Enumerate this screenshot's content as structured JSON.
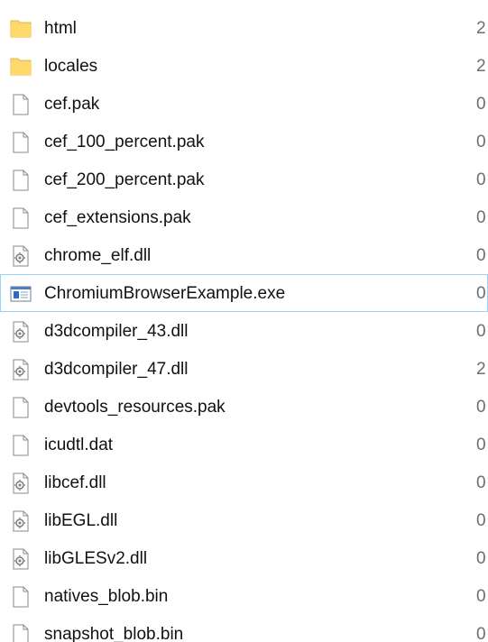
{
  "files": [
    {
      "name": "html",
      "type": "folder",
      "col": "2"
    },
    {
      "name": "locales",
      "type": "folder",
      "col": "2"
    },
    {
      "name": "cef.pak",
      "type": "file",
      "col": "0"
    },
    {
      "name": "cef_100_percent.pak",
      "type": "file",
      "col": "0"
    },
    {
      "name": "cef_200_percent.pak",
      "type": "file",
      "col": "0"
    },
    {
      "name": "cef_extensions.pak",
      "type": "file",
      "col": "0"
    },
    {
      "name": "chrome_elf.dll",
      "type": "dll",
      "col": "0"
    },
    {
      "name": "ChromiumBrowserExample.exe",
      "type": "exe",
      "col": "0",
      "selected": true
    },
    {
      "name": "d3dcompiler_43.dll",
      "type": "dll",
      "col": "0"
    },
    {
      "name": "d3dcompiler_47.dll",
      "type": "dll",
      "col": "2"
    },
    {
      "name": "devtools_resources.pak",
      "type": "file",
      "col": "0"
    },
    {
      "name": "icudtl.dat",
      "type": "file",
      "col": "0"
    },
    {
      "name": "libcef.dll",
      "type": "dll",
      "col": "0"
    },
    {
      "name": "libEGL.dll",
      "type": "dll",
      "col": "0"
    },
    {
      "name": "libGLESv2.dll",
      "type": "dll",
      "col": "0"
    },
    {
      "name": "natives_blob.bin",
      "type": "file",
      "col": "0"
    },
    {
      "name": "snapshot_blob.bin",
      "type": "file",
      "col": "0"
    }
  ],
  "colors": {
    "folder": "#f8d775",
    "selection_border": "#99d1ff",
    "text": "#111111",
    "secondary_text": "#6d6d6d"
  }
}
